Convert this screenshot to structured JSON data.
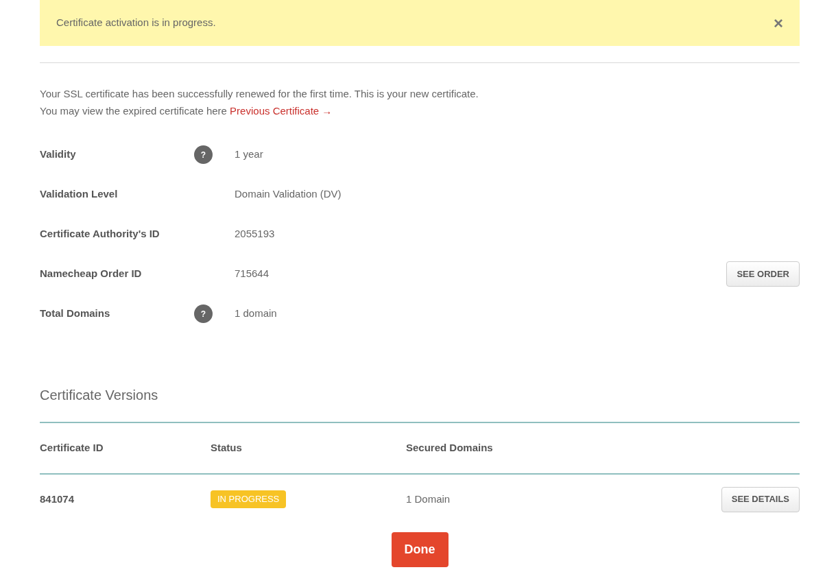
{
  "alert": {
    "message": "Certificate activation is in progress.",
    "close": "×"
  },
  "intro": {
    "line1": "Your SSL certificate has been successfully renewed for the first time. This is your new certificate.",
    "line2": "You may view the expired certificate here",
    "link": "Previous Certificate →"
  },
  "details": [
    {
      "label": "Validity",
      "help": "?",
      "value": "1 year"
    },
    {
      "label": "Validation Level",
      "value": "Domain Validation (DV)"
    },
    {
      "label": "Certificate Authority's ID",
      "value": "2055193"
    },
    {
      "label": "Namecheap Order ID",
      "value": "715644",
      "action": "SEE ORDER"
    },
    {
      "label": "Total Domains",
      "help": "?",
      "value": "1 domain"
    }
  ],
  "versions": {
    "title": "Certificate Versions",
    "columns": [
      "Certificate ID",
      "Status",
      "Secured Domains"
    ],
    "rows": [
      {
        "id": "841074",
        "status": {
          "kind": "in_progress",
          "label": "IN PROGRESS"
        },
        "domains": "1 Domain",
        "action": "SEE DETAILS"
      }
    ]
  },
  "done_button": "Done"
}
